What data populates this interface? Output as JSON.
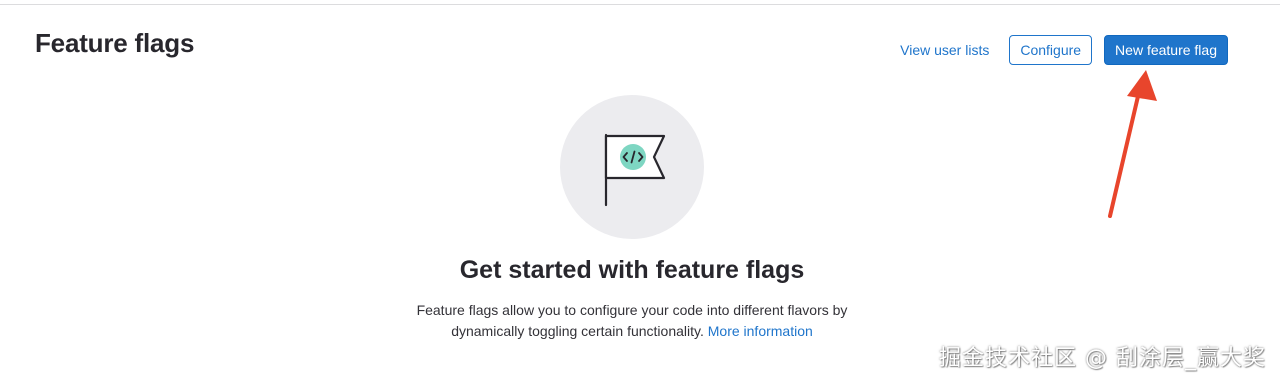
{
  "header": {
    "title": "Feature flags",
    "view_user_lists_label": "View user lists",
    "configure_label": "Configure",
    "new_feature_flag_label": "New feature flag"
  },
  "empty_state": {
    "illustration_icon": "feature-flag-code-icon",
    "title": "Get started with feature flags",
    "description": "Feature flags allow you to configure your code into different flavors by dynamically toggling certain functionality.",
    "more_info_label": "More information"
  },
  "annotation": {
    "arrow_color": "#e8452c",
    "watermark": "掘金技术社区 @ 刮涂层_赢大奖"
  },
  "colors": {
    "accent": "#1f75cb",
    "illustration_bg": "#ececef",
    "icon_teal": "#7ed6c2"
  }
}
